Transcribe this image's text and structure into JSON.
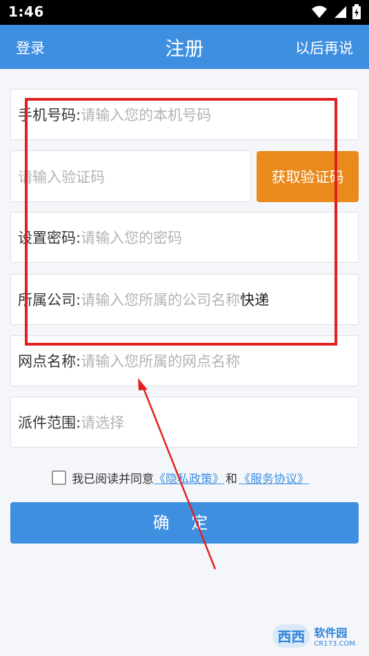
{
  "status_bar": {
    "time": "1:46"
  },
  "header": {
    "left_label": "登录",
    "title": "注册",
    "right_label": "以后再说"
  },
  "form": {
    "phone": {
      "label": "手机号码:",
      "placeholder": "请输入您的本机号码"
    },
    "code": {
      "placeholder": "请输入验证码",
      "button_label": "获取验证码"
    },
    "password": {
      "label": "设置密码:",
      "placeholder": "请输入您的密码"
    },
    "company": {
      "label": "所属公司:",
      "placeholder": "请输入您所属的公司名称",
      "value": "快递"
    },
    "branch": {
      "label": "网点名称:",
      "placeholder": "请输入您所属的网点名称"
    },
    "range": {
      "label": "派件范围:",
      "placeholder": "请选择"
    }
  },
  "agreement": {
    "text": "我已阅读并同意",
    "privacy_link": "《隐私政策》",
    "and": "和",
    "service_link": "《服务协议》"
  },
  "confirm_label": "确 定",
  "watermark": {
    "text": "软件园",
    "url": "CR173.COM",
    "logo_text": "西西"
  },
  "colors": {
    "accent": "#3f8fe1",
    "button_orange": "#ea8a1c",
    "annotation_red": "#e02020"
  }
}
